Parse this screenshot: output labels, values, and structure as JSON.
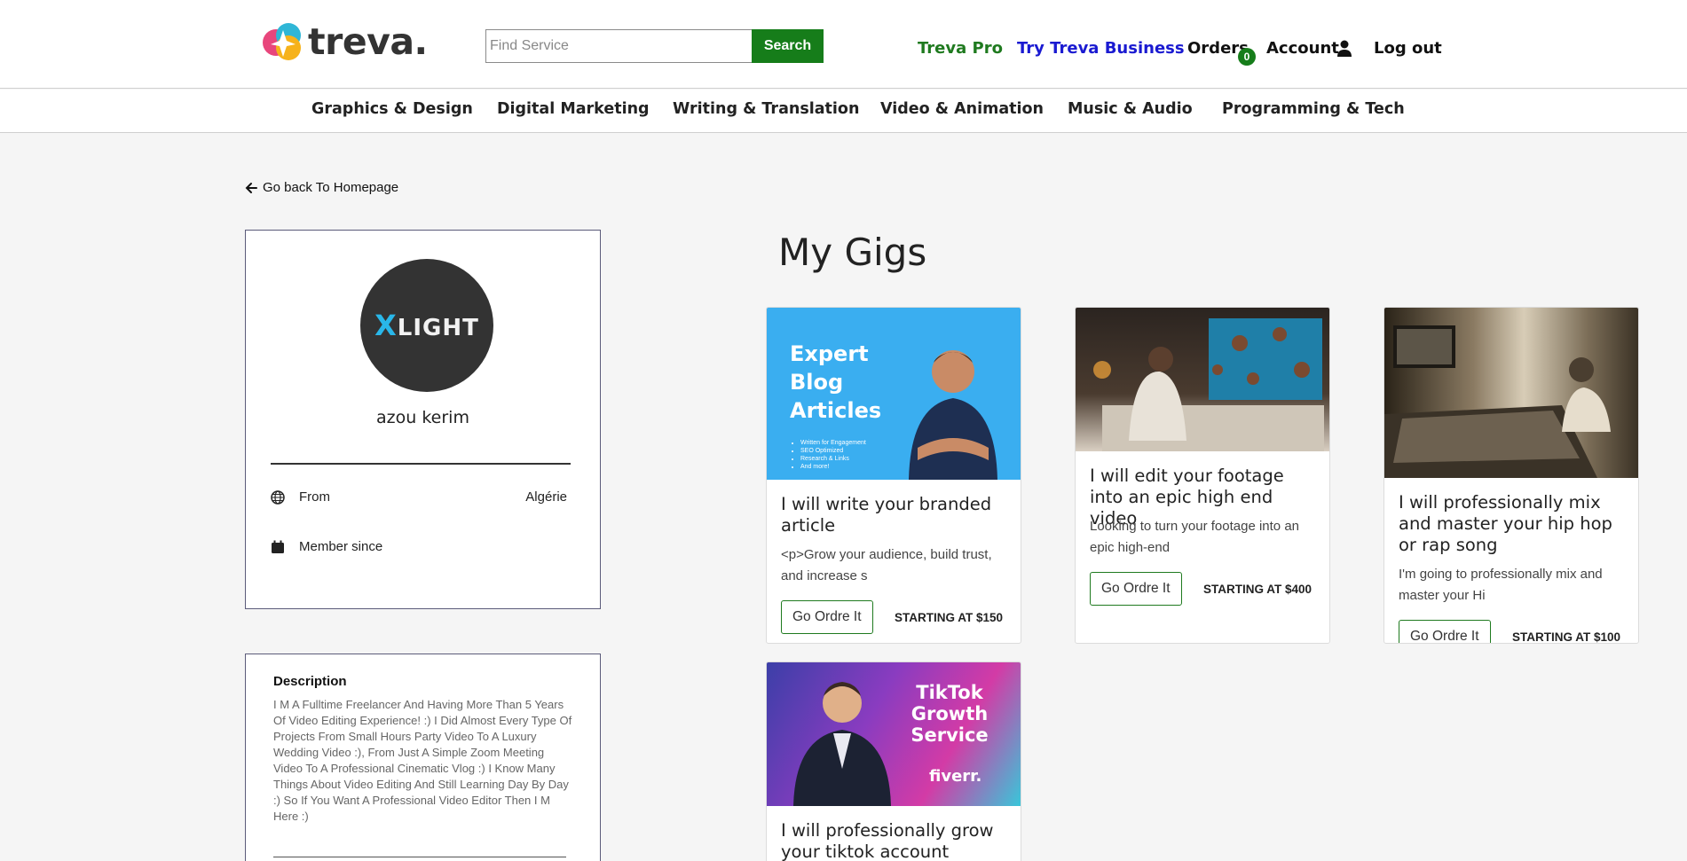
{
  "header": {
    "logo_text": "treva.",
    "search": {
      "placeholder": "Find Service",
      "button": "Search"
    },
    "links": {
      "pro": "Treva Pro",
      "business": "Try Treva Business",
      "orders": "Orders",
      "orders_count": "0",
      "account": "Account",
      "logout": "Log out"
    }
  },
  "categories": [
    "Graphics & Design",
    "Digital Marketing",
    "Writing & Translation",
    "Video & Animation",
    "Music & Audio",
    "Programming & Tech"
  ],
  "back_link": "Go back To Homepage",
  "profile": {
    "avatar_x": "X",
    "avatar_rest": "LIGHT",
    "name": "azou kerim",
    "from_label": "From",
    "from_value": "Algérie",
    "member_label": "Member since"
  },
  "description": {
    "title": "Description",
    "body": "I M A Fulltime Freelancer And Having More Than 5 Years Of Video Editing Experience! :) I Did Almost Every Type Of Projects From Small Hours Party Video To A Luxury Wedding Video :), From Just A Simple Zoom Meeting Video To A Professional Cinematic Vlog :) I Know Many Things About Video Editing And Still Learning Day By Day :) So If You Want A Professional Video Editor Then I M Here :)"
  },
  "gigs": {
    "title": "My Gigs",
    "items": [
      {
        "title": "I will write your branded article",
        "desc": "<p>Grow your audience, build trust, and increase s",
        "button": "Go Ordre It",
        "price": "STARTING AT $150",
        "image_text": "Expert Blog Articles",
        "image_bullets": [
          "Written for Engagement",
          "SEO Optimized",
          "Research & Links",
          "And more!"
        ]
      },
      {
        "title": "I will edit your footage into an epic high end video",
        "desc": "Looking to turn your footage into an epic high-end",
        "button": "Go Ordre It",
        "price": "STARTING AT $400"
      },
      {
        "title": "I will professionally mix and master your hip hop or rap song",
        "desc": "I'm going to professionally mix and master your Hi",
        "button": "Go Ordre It",
        "price": "STARTING AT $100"
      },
      {
        "title": "I will professionally grow your tiktok account",
        "image_text": "TikTok Growth Service",
        "image_brand": "fiverr."
      }
    ]
  },
  "colors": {
    "brand_green": "#167d1a",
    "business_blue": "#1a1ad1",
    "background": "#f5f5f5"
  }
}
